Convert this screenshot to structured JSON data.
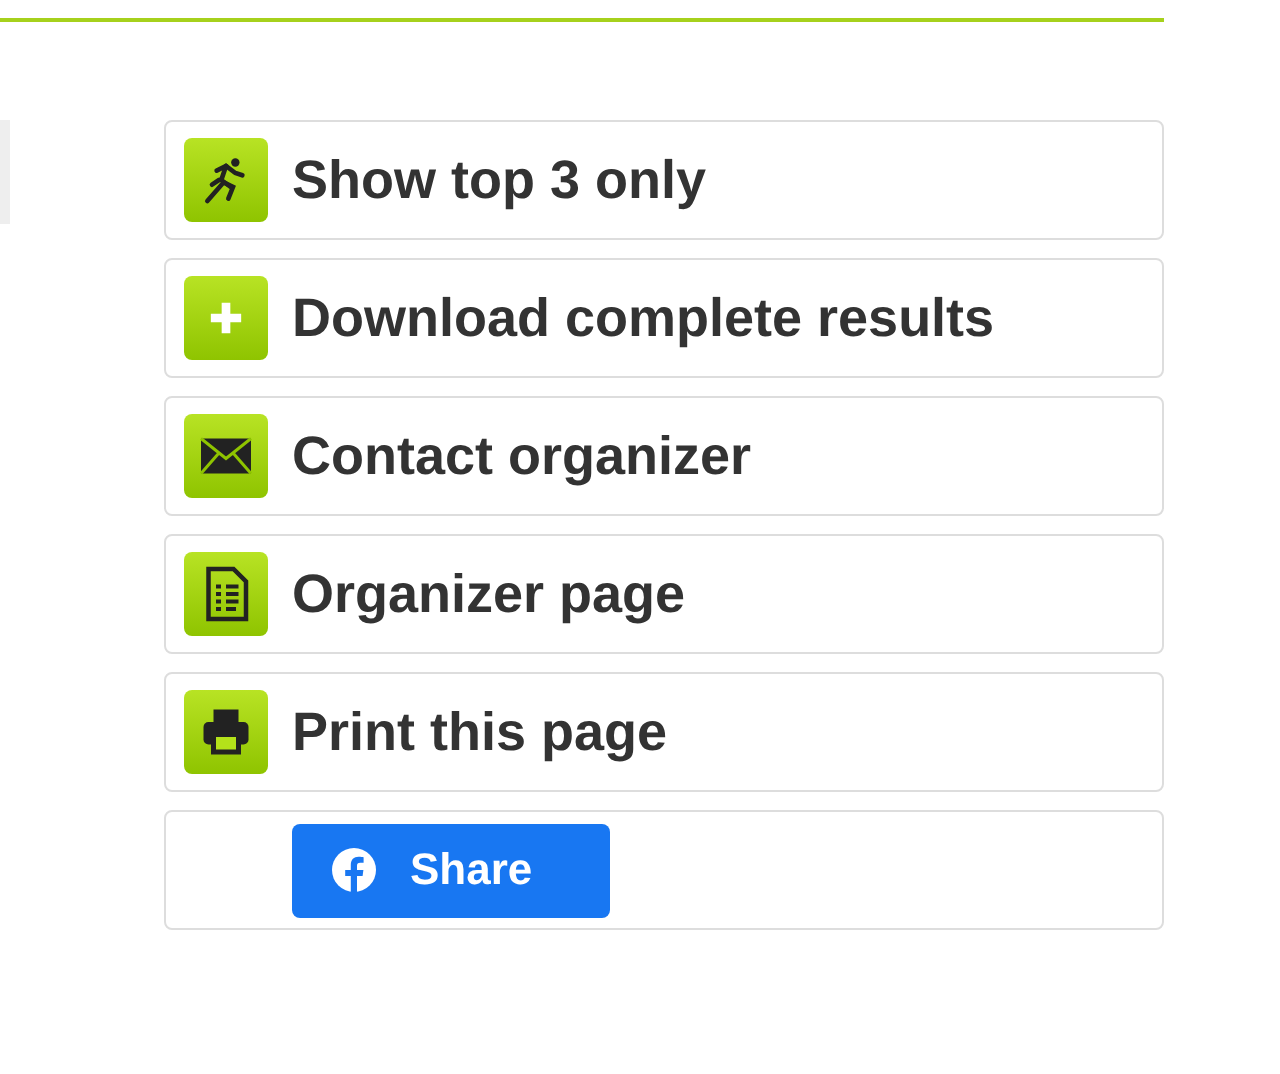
{
  "actions": [
    {
      "kind": "link",
      "label": "Show top 3 only"
    },
    {
      "kind": "link",
      "label": "Download complete results"
    },
    {
      "kind": "link",
      "label": "Contact organizer"
    },
    {
      "kind": "link",
      "label": "Organizer page"
    },
    {
      "kind": "link",
      "label": "Print this page"
    },
    {
      "kind": "share",
      "label": "Share"
    }
  ]
}
